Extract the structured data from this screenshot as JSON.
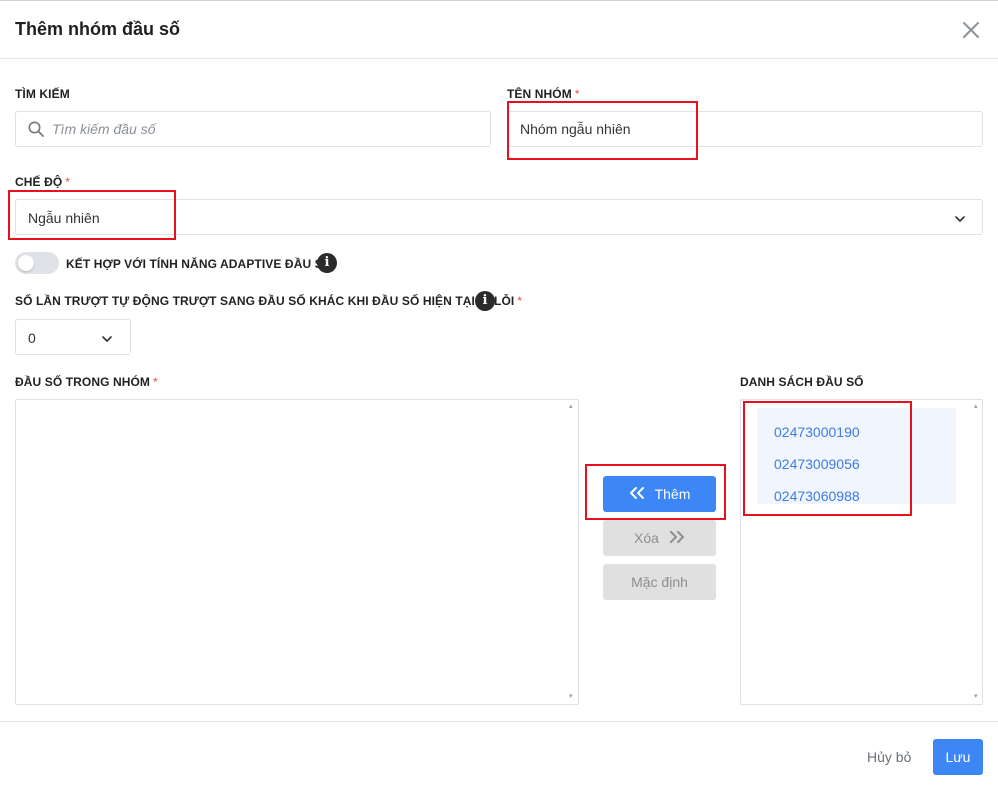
{
  "dialog": {
    "title": "Thêm nhóm đầu số"
  },
  "search": {
    "label": "TÌM KIẾM",
    "placeholder": "Tìm kiếm đầu số"
  },
  "group_name": {
    "label": "TÊN NHÓM",
    "required": "*",
    "value": "Nhóm ngẫu nhiên"
  },
  "mode": {
    "label": "CHẾ ĐỘ",
    "required": "*",
    "value": "Ngẫu nhiên"
  },
  "adaptive": {
    "label": "KẾT HỢP VỚI TÍNH NĂNG ADAPTIVE ĐẦU SỐ",
    "enabled": false
  },
  "retry": {
    "label": "SỐ LẦN TRƯỢT TỰ ĐỘNG TRƯỢT SANG ĐẦU SỐ KHÁC KHI ĐẦU SỐ HIỆN TẠI BỊ LỖI",
    "required": "*",
    "value": "0"
  },
  "in_group": {
    "label": "ĐẦU SỐ TRONG NHÓM",
    "required": "*",
    "items": []
  },
  "available": {
    "label": "DANH SÁCH ĐẦU SỐ",
    "items": [
      "02473000190",
      "02473009056",
      "02473060988"
    ]
  },
  "actions": {
    "add_label": "Thêm",
    "remove_label": "Xóa",
    "default_label": "Mặc định"
  },
  "footer": {
    "cancel_label": "Hủy bỏ",
    "save_label": "Lưu"
  },
  "colors": {
    "primary": "#3d86f5",
    "highlight": "#e8101c",
    "link": "#3b7de3"
  }
}
